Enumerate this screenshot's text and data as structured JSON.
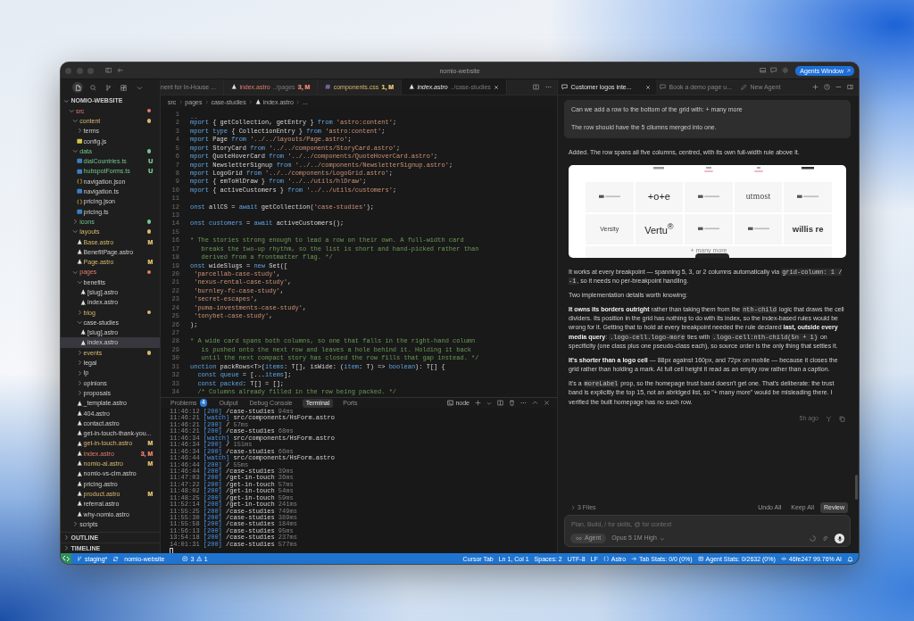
{
  "window": {
    "title": "nomio-website",
    "agents_button": "Agents Window"
  },
  "sidebar": {
    "project": {
      "label": "NOMIO-WEBSITE",
      "expanded": true
    },
    "tree": [
      {
        "name": "src",
        "kind": "folder",
        "expanded": true,
        "color": "#e27d6c",
        "selected": false,
        "children": [
          {
            "name": "content",
            "kind": "folder",
            "expanded": true,
            "color": "#d8b86e",
            "selected": false,
            "children": [
              {
                "name": "terms",
                "kind": "folder",
                "expanded": false,
                "selected": false
              },
              {
                "name": "config.js",
                "kind": "js",
                "selected": false
              }
            ]
          },
          {
            "name": "data",
            "kind": "folder",
            "expanded": true,
            "color": "#73c48f",
            "selected": false,
            "children": [
              {
                "name": "dialCountries.ts",
                "kind": "ts",
                "color": "#73c48f",
                "badge": "U",
                "selected": false
              },
              {
                "name": "hubspotForms.ts",
                "kind": "ts",
                "color": "#73c48f",
                "badge": "U",
                "selected": false
              },
              {
                "name": "navigation.json",
                "kind": "json",
                "selected": false
              },
              {
                "name": "navigation.ts",
                "kind": "ts",
                "selected": false
              },
              {
                "name": "pricing.json",
                "kind": "json",
                "selected": false
              },
              {
                "name": "pricing.ts",
                "kind": "ts",
                "selected": false
              }
            ]
          },
          {
            "name": "icons",
            "kind": "folder",
            "expanded": false,
            "color": "#73c48f",
            "selected": false
          },
          {
            "name": "layouts",
            "kind": "folder",
            "expanded": true,
            "color": "#d8b86e",
            "selected": false,
            "children": [
              {
                "name": "Base.astro",
                "kind": "astro",
                "color": "#d8b86e",
                "badge": "M",
                "selected": false
              },
              {
                "name": "BenefitPage.astro",
                "kind": "astro",
                "selected": false
              },
              {
                "name": "Page.astro",
                "kind": "astro",
                "color": "#d8b86e",
                "badge": "M",
                "selected": false
              }
            ]
          },
          {
            "name": "pages",
            "kind": "folder",
            "expanded": true,
            "color": "#e27d6c",
            "selected": false,
            "children": [
              {
                "name": "benefits",
                "kind": "folder",
                "expanded": true,
                "selected": false,
                "children": [
                  {
                    "name": "[slug].astro",
                    "kind": "astro",
                    "selected": false
                  },
                  {
                    "name": "index.astro",
                    "kind": "astro",
                    "selected": false
                  }
                ]
              },
              {
                "name": "blog",
                "kind": "folder",
                "expanded": false,
                "color": "#d8b86e",
                "selected": false
              },
              {
                "name": "case-studies",
                "kind": "folder",
                "expanded": true,
                "selected": false,
                "children": [
                  {
                    "name": "[slug].astro",
                    "kind": "astro",
                    "selected": false
                  },
                  {
                    "name": "index.astro",
                    "kind": "astro",
                    "selected": true
                  }
                ]
              },
              {
                "name": "events",
                "kind": "folder",
                "expanded": false,
                "color": "#d8b86e",
                "selected": false
              },
              {
                "name": "legal",
                "kind": "folder",
                "expanded": false,
                "selected": false
              },
              {
                "name": "lp",
                "kind": "folder",
                "expanded": false,
                "selected": false
              },
              {
                "name": "opinions",
                "kind": "folder",
                "expanded": false,
                "selected": false
              },
              {
                "name": "proposals",
                "kind": "folder",
                "expanded": false,
                "selected": false
              },
              {
                "name": "_template.astro",
                "kind": "astro",
                "selected": false
              },
              {
                "name": "404.astro",
                "kind": "astro",
                "selected": false
              },
              {
                "name": "contact.astro",
                "kind": "astro",
                "selected": false
              },
              {
                "name": "get-in-touch-thank-you...",
                "kind": "astro",
                "selected": false
              },
              {
                "name": "get-in-touch.astro",
                "kind": "astro",
                "color": "#d8b86e",
                "badge": "M",
                "selected": false
              },
              {
                "name": "index.astro",
                "kind": "astro",
                "color": "#e27d6c",
                "badge": "3, M",
                "selected": false
              },
              {
                "name": "nomio-ai.astro",
                "kind": "astro",
                "color": "#d8b86e",
                "badge": "M",
                "selected": false
              },
              {
                "name": "nomio-vs-clm.astro",
                "kind": "astro",
                "selected": false
              },
              {
                "name": "pricing.astro",
                "kind": "astro",
                "selected": false
              },
              {
                "name": "product.astro",
                "kind": "astro",
                "color": "#d8b86e",
                "badge": "M",
                "selected": false
              },
              {
                "name": "referral.astro",
                "kind": "astro",
                "selected": false
              },
              {
                "name": "why-nomio.astro",
                "kind": "astro",
                "selected": false
              }
            ]
          },
          {
            "name": "scripts",
            "kind": "folder",
            "expanded": false,
            "selected": false
          }
        ]
      }
    ],
    "sections": [
      {
        "label": "OUTLINE",
        "expanded": false
      },
      {
        "label": "TIMELINE",
        "expanded": false
      }
    ]
  },
  "editor": {
    "tabs": [
      {
        "label": "nent for In-House ...",
        "preview": false,
        "selected": false
      },
      {
        "label": "index.astro",
        "kind": "astro",
        "detail": "../pages",
        "badge": "3, M",
        "color": "#e27d6c",
        "preview": false,
        "selected": false
      },
      {
        "label": "components.css",
        "kind": "css",
        "badge": "1, M",
        "color": "#d8b86e",
        "preview": false,
        "selected": false
      },
      {
        "label": "index.astro",
        "kind": "astro",
        "detail": "../case-studies",
        "preview": true,
        "selected": true
      }
    ],
    "breadcrumb": [
      {
        "label": "src"
      },
      {
        "label": "pages"
      },
      {
        "label": "case-studies"
      },
      {
        "label": "index.astro",
        "kind": "astro"
      },
      {
        "label": "..."
      }
    ],
    "lines": [
      {
        "number": "1",
        "text": "--",
        "kind": "meta"
      },
      {
        "number": "2",
        "text": "mport { getCollection, getEntry } from 'astro:content';",
        "kind": "code"
      },
      {
        "number": "3",
        "text": "mport type { CollectionEntry } from 'astro:content';",
        "kind": "code"
      },
      {
        "number": "4",
        "text": "mport Page from '../../layouts/Page.astro';",
        "kind": "code"
      },
      {
        "number": "5",
        "text": "mport StoryCard from '../../components/StoryCard.astro';",
        "kind": "code"
      },
      {
        "number": "6",
        "text": "mport QuoteHoverCard from '../../components/QuoteHoverCard.astro';",
        "kind": "code"
      },
      {
        "number": "7",
        "text": "mport NewsletterSignup from '../../components/NewsletterSignup.astro';",
        "kind": "code"
      },
      {
        "number": "8",
        "text": "mport LogoGrid from '../../components/LogoGrid.astro';",
        "kind": "code"
      },
      {
        "number": "9",
        "text": "mport { emToHlDraw } from '../../utils/hlDraw';",
        "kind": "code"
      },
      {
        "number": "10",
        "text": "mport { activeCustomers } from '../../utils/customers';",
        "kind": "code"
      },
      {
        "number": "11"
      },
      {
        "number": "12",
        "text": "onst allCS = await getCollection('case-studies');",
        "kind": "code"
      },
      {
        "number": "13"
      },
      {
        "number": "14",
        "text": "onst customers = await activeCustomers();",
        "kind": "code"
      },
      {
        "number": "15"
      },
      {
        "number": "16",
        "text": "* The stories strong enough to lead a row on their own. A full-width card",
        "kind": "comment"
      },
      {
        "number": "17",
        "text": "   breaks the two-up rhythm, so the list is short and hand-picked rather than",
        "kind": "comment"
      },
      {
        "number": "18",
        "text": "   derived from a frontmatter flag. */",
        "kind": "comment"
      },
      {
        "number": "19",
        "text": "onst wideSlugs = new Set([",
        "kind": "code"
      },
      {
        "number": "20",
        "text": " 'parcellab-case-study',",
        "kind": "code"
      },
      {
        "number": "21",
        "text": " 'nexus-rental-case-study',",
        "kind": "code"
      },
      {
        "number": "22",
        "text": " 'burnley-fc-case-study',",
        "kind": "code"
      },
      {
        "number": "23",
        "text": " 'secret-escapes',",
        "kind": "code"
      },
      {
        "number": "24",
        "text": " 'puma-investments-case-study',",
        "kind": "code"
      },
      {
        "number": "25",
        "text": " 'tonybet-case-study',",
        "kind": "code"
      },
      {
        "number": "26",
        "text": ");",
        "kind": "code"
      },
      {
        "number": "27"
      },
      {
        "number": "28",
        "text": "* A wide card spans both columns, so one that falls in the right-hand column",
        "kind": "comment"
      },
      {
        "number": "29",
        "text": "   is pushed onto the next row and leaves a hole behind it. Holding it back",
        "kind": "comment"
      },
      {
        "number": "30",
        "text": "   until the next compact story has closed the row fills that gap instead. */",
        "kind": "comment"
      },
      {
        "number": "31",
        "text": "unction packRows<T>(items: T[], isWide: (item: T) => boolean): T[] {",
        "kind": "code"
      },
      {
        "number": "32",
        "text": "  const queue = [...items];",
        "kind": "code"
      },
      {
        "number": "33",
        "text": "  const packed: T[] = [];",
        "kind": "code"
      },
      {
        "number": "34",
        "text": "  /* Columns already filled in the row being packed. */",
        "kind": "comment"
      }
    ]
  },
  "panel": {
    "tabs": [
      {
        "label": "Problems",
        "badge": "4",
        "selected": false
      },
      {
        "label": "Output",
        "selected": false
      },
      {
        "label": "Debug Console",
        "selected": false
      },
      {
        "label": "Terminal",
        "selected": true
      },
      {
        "label": "Ports",
        "selected": false
      }
    ],
    "shell": "node",
    "lines": [
      "11:46:12 [200] /case-studies 94ms",
      "11:46:21 [watch] src/components/HsForm.astro",
      "11:46:21 [200] / 57ms",
      "11:46:21 [200] /case-studies 68ms",
      "11:46:34 [watch] src/components/HsForm.astro",
      "11:46:34 [200] / 151ms",
      "11:46:34 [200] /case-studies 66ms",
      "11:46:44 [watch] src/components/HsForm.astro",
      "11:46:44 [200] / 55ms",
      "11:46:44 [200] /case-studies 39ms",
      "11:47:03 [200] /get-in-touch 36ms",
      "11:47:22 [200] /get-in-touch 57ms",
      "11:48:02 [200] /get-in-touch 54ms",
      "11:48:25 [200] /get-in-touch 59ms",
      "11:52:14 [200] /get-in-touch 241ms",
      "11:55:25 [200] /case-studies 749ms",
      "11:55:30 [200] /case-studies 389ms",
      "11:55:58 [200] /case-studies 184ms",
      "11:56:13 [200] /case-studies 95ms",
      "13:54:18 [200] /case-studies 237ms",
      "14:01:31 [200] /case-studies 577ms"
    ]
  },
  "agent": {
    "tabs": [
      {
        "label": "Customer logos inte...",
        "kind": "chat",
        "selected": true
      },
      {
        "label": "Book a demo page u...",
        "kind": "chat",
        "selected": false
      },
      {
        "label": "New Agent",
        "kind": "new",
        "selected": false
      }
    ],
    "prompt": [
      "Can we add a row to the bottom of the grid with: + many more",
      "The row should have the 5 cilumns merged into one."
    ],
    "intro": "Added. The row spans all five columns, centred, with its own full-width rule above it.",
    "screenshot": {
      "rows": [
        [
          {
            "kind": "mark"
          },
          {
            "kind": "sans",
            "text": "+o+e"
          },
          {
            "kind": "mark"
          },
          {
            "kind": "serif",
            "text": "utmost"
          },
          {
            "kind": "mark"
          }
        ],
        [
          {
            "kind": "small",
            "text": "Versity"
          },
          {
            "kind": "sans",
            "text": "Vertu$^{®}$"
          },
          {
            "kind": "mark"
          },
          {
            "kind": "mark"
          },
          {
            "kind": "bold",
            "text": "willis re"
          }
        ]
      ],
      "footer": "+ many more"
    },
    "paragraphs": [
      [
        {
          "kind": "plain",
          "text": "It works at every breakpoint — spanning 5, 3, or 2 columns automatically via "
        },
        {
          "kind": "code",
          "text": "grid-column: 1 / -1"
        },
        {
          "kind": "plain",
          "text": ", so it needs no per-breakpoint handling."
        }
      ],
      [
        {
          "kind": "plain",
          "text": "Two implementation details worth knowing:"
        }
      ],
      [
        {
          "kind": "bold",
          "text": "It owns its borders outright"
        },
        {
          "kind": "plain",
          "text": " rather than taking them from the "
        },
        {
          "kind": "code",
          "text": "nth-child"
        },
        {
          "kind": "plain",
          "text": " logic that draws the cell dividers. Its position in the grid has nothing to do with its index, so the index-based rules would be wrong for it. Getting that to hold at every breakpoint needed the rule declared "
        },
        {
          "kind": "bold",
          "text": "last, outside every media query"
        },
        {
          "kind": "plain",
          "text": ": "
        },
        {
          "kind": "code",
          "text": ".logo-cell.logo-more"
        },
        {
          "kind": "plain",
          "text": " ties with "
        },
        {
          "kind": "code",
          "text": ".logo-cell:nth-child(5n + 1)"
        },
        {
          "kind": "plain",
          "text": " on specificity (one class plus one pseudo-class each), so source order is the only thing that settles it."
        }
      ],
      [
        {
          "kind": "bold",
          "text": "It's shorter than a logo cell"
        },
        {
          "kind": "plain",
          "text": " — 88px against 160px, and 72px on mobile — because it closes the grid rather than holding a mark. At full cell height it read as an empty row rather than a caption."
        }
      ],
      [
        {
          "kind": "plain",
          "text": "It's a "
        },
        {
          "kind": "code",
          "text": "moreLabel"
        },
        {
          "kind": "plain",
          "text": " prop, so the homepage trust band doesn't get one. That's deliberate: the trust band is explicitly the top 15, not an abridged list, so \"+ many more\" would be misleading there. I verified the built homepage has no such row."
        }
      ]
    ],
    "time": "5h ago",
    "files": "3 Files",
    "actions": [
      {
        "label": "Undo All",
        "kind": "plain"
      },
      {
        "label": "Keep All",
        "kind": "plain"
      },
      {
        "label": "Review",
        "kind": "primary"
      }
    ],
    "input": {
      "placeholder": "Plan, Build, / for skills, @ for context"
    },
    "mode": "Agent",
    "model": "Opus 5 1M High"
  },
  "status_bar": {
    "branch": "staging*",
    "project": "nomio-website",
    "errors": "3",
    "warnings": "1",
    "items": [
      {
        "kind": "plain",
        "text": "Cursor Tab"
      },
      {
        "kind": "plain",
        "text": "Ln 1, Col 1"
      },
      {
        "kind": "plain",
        "text": "Spaces: 2"
      },
      {
        "kind": "plain",
        "text": "UTF-8"
      },
      {
        "kind": "plain",
        "text": "LF"
      },
      {
        "kind": "language",
        "text": "Astro"
      },
      {
        "kind": "tab",
        "text": "Tab Stats: 0/0 (0%)"
      },
      {
        "kind": "agent",
        "text": "Agent Stats: 0/2632 (0%)"
      },
      {
        "kind": "commit",
        "text": "46fe247 99.76% AI"
      }
    ]
  }
}
